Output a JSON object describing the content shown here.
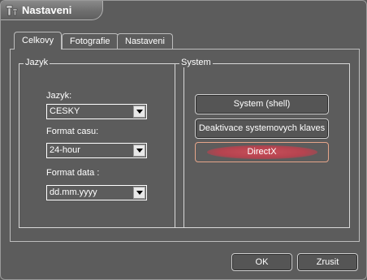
{
  "window": {
    "title": "Nastaveni"
  },
  "tabs": [
    {
      "label": "Celkovy",
      "active": true
    },
    {
      "label": "Fotografie",
      "active": false
    },
    {
      "label": "Nastaveni",
      "active": false
    }
  ],
  "jazyk_group": {
    "legend": "Jazyk",
    "language": {
      "label": "Jazyk:",
      "value": "CESKY"
    },
    "time_format": {
      "label": "Format casu:",
      "value": "24-hour"
    },
    "date_format": {
      "label": "Format data :",
      "value": "dd.mm.yyyy"
    }
  },
  "system_group": {
    "legend": "System",
    "shell_button": "System (shell)",
    "deactivate_button": "Deaktivace systemovych klaves",
    "directx_button": "DirectX"
  },
  "footer": {
    "ok_label": "OK",
    "cancel_label": "Zrusit"
  },
  "colors": {
    "background": "#5c5c5c",
    "highlight": "#c8505a",
    "border": "#bdbdbd"
  }
}
